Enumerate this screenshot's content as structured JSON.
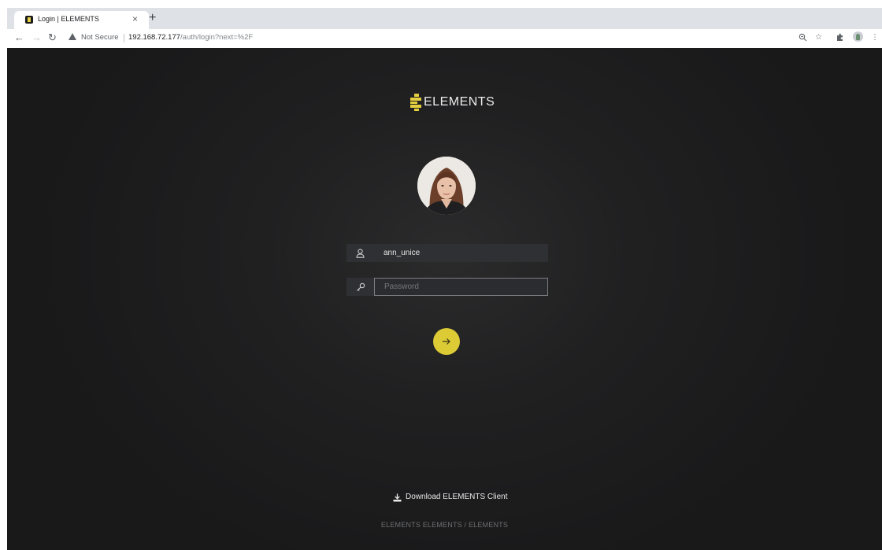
{
  "browser": {
    "tab_title": "Login | ELEMENTS",
    "tab_close": "×",
    "new_tab": "+",
    "security_label": "Not Secure",
    "url_host": "192.168.72.177",
    "url_path": "/auth/login?next=%2F"
  },
  "login": {
    "logo_text": "ELEMENTS",
    "username_value": "ann_unice",
    "password_placeholder": "Password",
    "download_label": "Download ELEMENTS Client",
    "footer_text": "ELEMENTS ELEMENTS / ELEMENTS"
  },
  "colors": {
    "accent": "#dccb35",
    "background": "#1c1c1d",
    "field": "#2f3033"
  },
  "icons": [
    "user-icon",
    "key-icon",
    "arrow-right-icon",
    "download-icon",
    "warning-icon",
    "zoom-icon",
    "star-icon",
    "extensions-icon",
    "menu-icon"
  ]
}
